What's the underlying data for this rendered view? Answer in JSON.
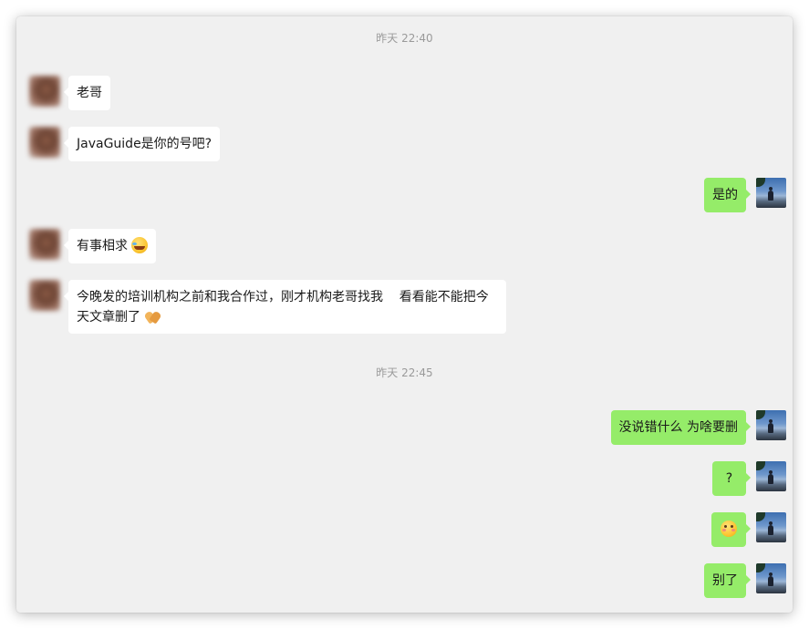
{
  "timestamps": [
    "昨天 22:40",
    "昨天 22:45"
  ],
  "messages": [
    {
      "side": "left",
      "text": "老哥"
    },
    {
      "side": "left",
      "text": "JavaGuide是你的号吧?"
    },
    {
      "side": "right",
      "text": "是的"
    },
    {
      "side": "left",
      "text": "有事相求",
      "emoji": "laughing-tears-emoji"
    },
    {
      "side": "left",
      "line1": "今晚发的培训机构之前和我合作过，刚才机构老哥找我    看看能不能把今",
      "line2": "天文章删了",
      "emoji": "pleading-hands-emoji"
    },
    {
      "side": "right",
      "text": "没说错什么 为啥要删"
    },
    {
      "side": "right",
      "text": "?"
    },
    {
      "side": "right",
      "emoji": "blushing-face-emoji"
    },
    {
      "side": "right",
      "text": "别了"
    }
  ],
  "colors": {
    "background": "#f0f0f0",
    "received_bubble": "#ffffff",
    "sent_bubble": "#95ec69",
    "timestamp_text": "#9a9a9a"
  }
}
